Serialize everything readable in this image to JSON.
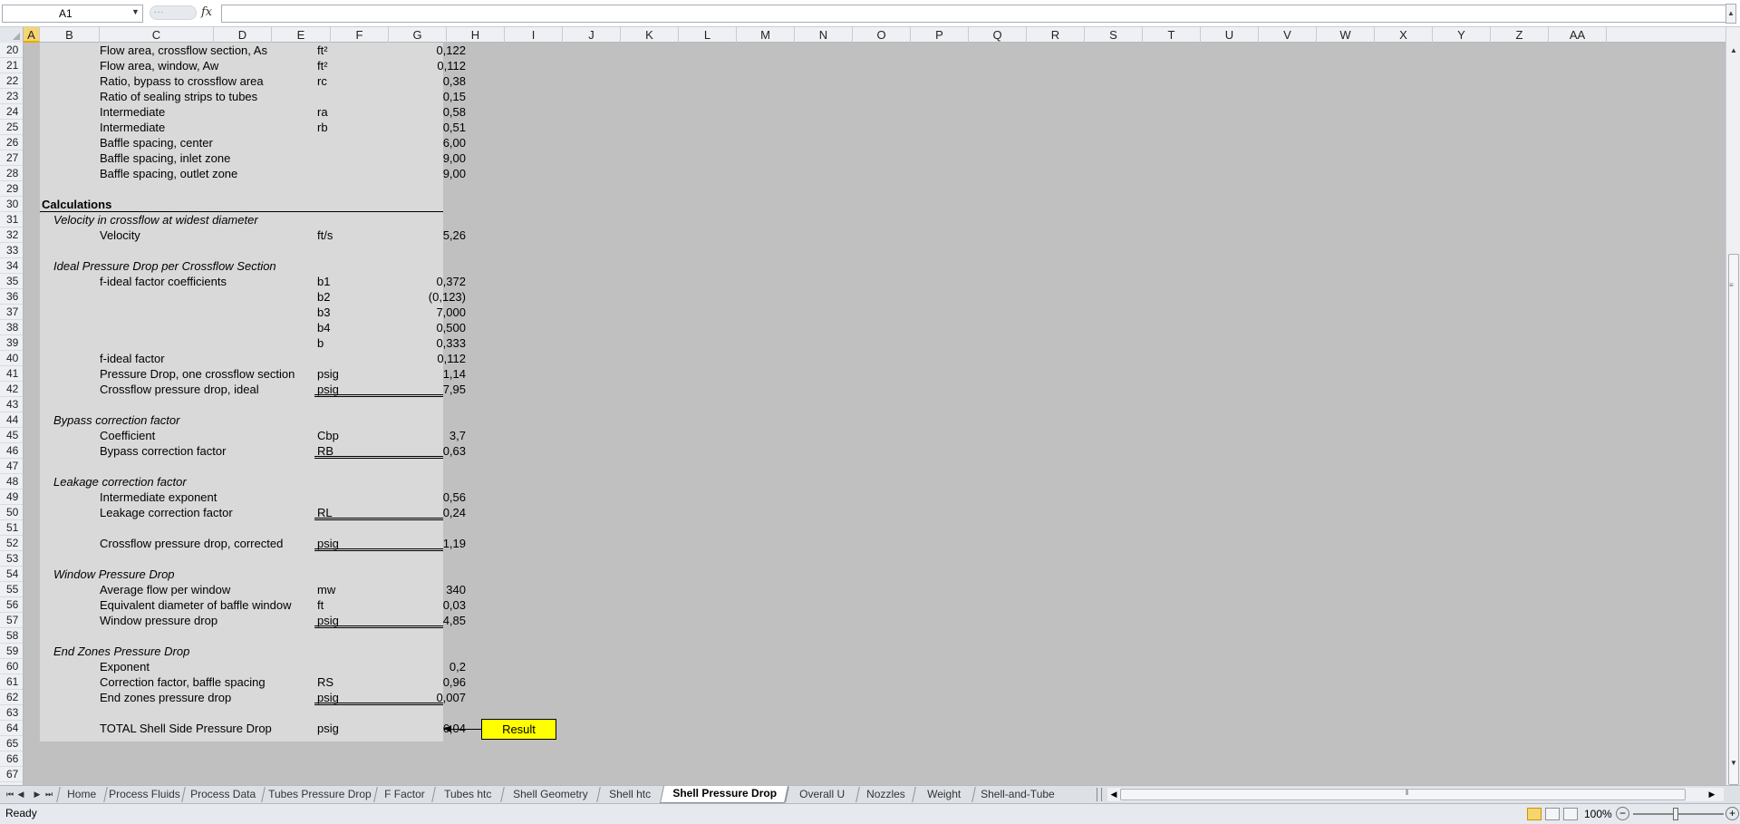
{
  "formula_bar": {
    "name_box": "A1",
    "formula": "",
    "fx_label": "fx",
    "fx_dots": "...",
    "name_box_arrow": "▼",
    "right_button": "▲"
  },
  "columns": [
    "A",
    "B",
    "C",
    "D",
    "E",
    "F",
    "G",
    "H",
    "I",
    "J",
    "K",
    "L",
    "M",
    "N",
    "O",
    "P",
    "Q",
    "R",
    "S",
    "T",
    "U",
    "V",
    "W",
    "X",
    "Y",
    "Z",
    "AA"
  ],
  "active_column": "A",
  "rows": [
    {
      "n": "20",
      "label": "Flow area, crossflow section, As",
      "unit": "ft²",
      "value": "0,122"
    },
    {
      "n": "21",
      "label": "Flow area, window, Aw",
      "unit": "ft²",
      "value": "0,112"
    },
    {
      "n": "22",
      "label": "Ratio, bypass to crossflow area",
      "unit": "rc",
      "value": "0,38"
    },
    {
      "n": "23",
      "label": "Ratio of sealing strips to tubes",
      "unit": "",
      "value": "0,15"
    },
    {
      "n": "24",
      "label": "Intermediate",
      "unit": "ra",
      "value": "0,58"
    },
    {
      "n": "25",
      "label": "Intermediate",
      "unit": "rb",
      "value": "0,51"
    },
    {
      "n": "26",
      "label": "Baffle spacing, center",
      "unit": "",
      "value": "6,00"
    },
    {
      "n": "27",
      "label": "Baffle spacing, inlet zone",
      "unit": "",
      "value": "9,00"
    },
    {
      "n": "28",
      "label": "Baffle spacing, outlet zone",
      "unit": "",
      "value": "9,00"
    },
    {
      "n": "29",
      "label": "",
      "unit": "",
      "value": ""
    },
    {
      "n": "30",
      "section": "Calculations"
    },
    {
      "n": "31",
      "sub": "Velocity in crossflow at widest diameter"
    },
    {
      "n": "32",
      "label": "Velocity",
      "unit": "ft/s",
      "value": "5,26"
    },
    {
      "n": "33",
      "label": "",
      "unit": "",
      "value": ""
    },
    {
      "n": "34",
      "sub": "Ideal Pressure Drop per Crossflow Section"
    },
    {
      "n": "35",
      "label": "f-ideal factor coefficients",
      "unit": "b1",
      "value": "0,372"
    },
    {
      "n": "36",
      "label": "",
      "unit": "b2",
      "value": "(0,123)"
    },
    {
      "n": "37",
      "label": "",
      "unit": "b3",
      "value": "7,000"
    },
    {
      "n": "38",
      "label": "",
      "unit": "b4",
      "value": "0,500"
    },
    {
      "n": "39",
      "label": "",
      "unit": "b",
      "value": "0,333"
    },
    {
      "n": "40",
      "label": "f-ideal factor",
      "unit": "",
      "value": "0,112"
    },
    {
      "n": "41",
      "label": "Pressure Drop, one crossflow section",
      "unit": "psig",
      "value": "1,14"
    },
    {
      "n": "42",
      "label": "Crossflow pressure drop, ideal",
      "unit": "psig",
      "value": "7,95",
      "underline": true
    },
    {
      "n": "43",
      "label": "",
      "unit": "",
      "value": ""
    },
    {
      "n": "44",
      "sub": "Bypass correction factor"
    },
    {
      "n": "45",
      "label": "Coefficient",
      "unit": "Cbp",
      "value": "3,7"
    },
    {
      "n": "46",
      "label": "Bypass correction factor",
      "unit": "RB",
      "value": "0,63",
      "underline": true
    },
    {
      "n": "47",
      "label": "",
      "unit": "",
      "value": ""
    },
    {
      "n": "48",
      "sub": "Leakage correction factor"
    },
    {
      "n": "49",
      "label": "Intermediate exponent",
      "unit": "",
      "value": "0,56"
    },
    {
      "n": "50",
      "label": "Leakage correction factor",
      "unit": "RL",
      "value": "0,24",
      "underline": true
    },
    {
      "n": "51",
      "label": "",
      "unit": "",
      "value": ""
    },
    {
      "n": "52",
      "label": "Crossflow pressure drop, corrected",
      "unit": "psig",
      "value": "1,19",
      "underline": true
    },
    {
      "n": "53",
      "label": "",
      "unit": "",
      "value": ""
    },
    {
      "n": "54",
      "sub": "Window Pressure Drop"
    },
    {
      "n": "55",
      "label": "Average flow per window",
      "unit": "mw",
      "value": "340"
    },
    {
      "n": "56",
      "label": "Equivalent diameter of baffle window",
      "unit": "ft",
      "value": "0,03"
    },
    {
      "n": "57",
      "label": "Window pressure drop",
      "unit": "psig",
      "value": "4,85",
      "underline": true
    },
    {
      "n": "58",
      "label": "",
      "unit": "",
      "value": ""
    },
    {
      "n": "59",
      "sub": "End Zones Pressure Drop"
    },
    {
      "n": "60",
      "label": "Exponent",
      "unit": "",
      "value": "0,2"
    },
    {
      "n": "61",
      "label": "Correction factor, baffle spacing",
      "unit": "RS",
      "value": "0,96"
    },
    {
      "n": "62",
      "label": "End zones pressure drop",
      "unit": "psig",
      "value": "0,007",
      "underline": true
    },
    {
      "n": "63",
      "label": "",
      "unit": "",
      "value": ""
    },
    {
      "n": "64",
      "label": "TOTAL Shell Side Pressure Drop",
      "unit": "psig",
      "value": "6,04"
    },
    {
      "n": "65",
      "label": "",
      "unit": "",
      "value": ""
    },
    {
      "n": "66",
      "label": "",
      "unit": "",
      "value": ""
    },
    {
      "n": "67",
      "label": "",
      "unit": "",
      "value": ""
    }
  ],
  "result_label": "Result",
  "tabs": [
    {
      "label": "Home"
    },
    {
      "label": "Process Fluids"
    },
    {
      "label": "Process Data"
    },
    {
      "label": "Tubes Pressure Drop"
    },
    {
      "label": "F Factor"
    },
    {
      "label": "Tubes htc"
    },
    {
      "label": "Shell Geometry"
    },
    {
      "label": "Shell htc"
    },
    {
      "label": "Shell Pressure Drop",
      "active": true
    },
    {
      "label": "Overall U"
    },
    {
      "label": "Nozzles"
    },
    {
      "label": "Weight"
    },
    {
      "label": "Shell-and-Tube"
    }
  ],
  "tab_nav": [
    "⏮",
    "◀",
    "▶",
    "⏭"
  ],
  "status": {
    "text": "Ready",
    "zoom": "100%",
    "zoom_out": "−",
    "zoom_in": "+"
  },
  "icons": {
    "scroll_up": "▲",
    "scroll_down": "▼",
    "scroll_left": "◀",
    "scroll_right": "▶",
    "grip_v": "≡",
    "grip_h": "⦀"
  }
}
